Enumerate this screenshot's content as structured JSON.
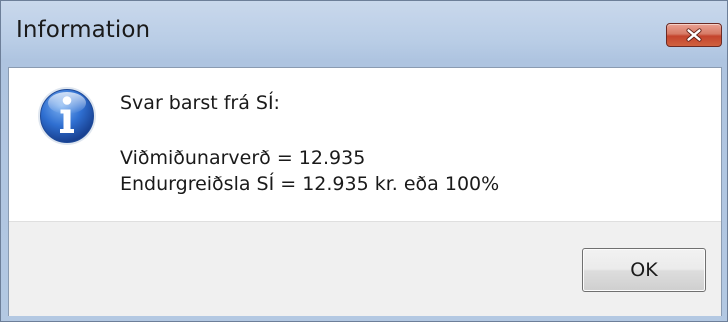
{
  "window": {
    "title": "Information"
  },
  "dialog": {
    "icon": "information-icon",
    "message_line1": "Svar barst frá SÍ:",
    "message_line2": "Viðmiðunarverð = 12.935",
    "message_line3": "Endurgreiðsla SÍ = 12.935 kr. eða 100%",
    "ok_label": "OK"
  },
  "colors": {
    "title_bar": "#b9cde6",
    "close_button": "#c4442d",
    "info_icon": "#2a66c9",
    "footer": "#f0f0f0"
  }
}
